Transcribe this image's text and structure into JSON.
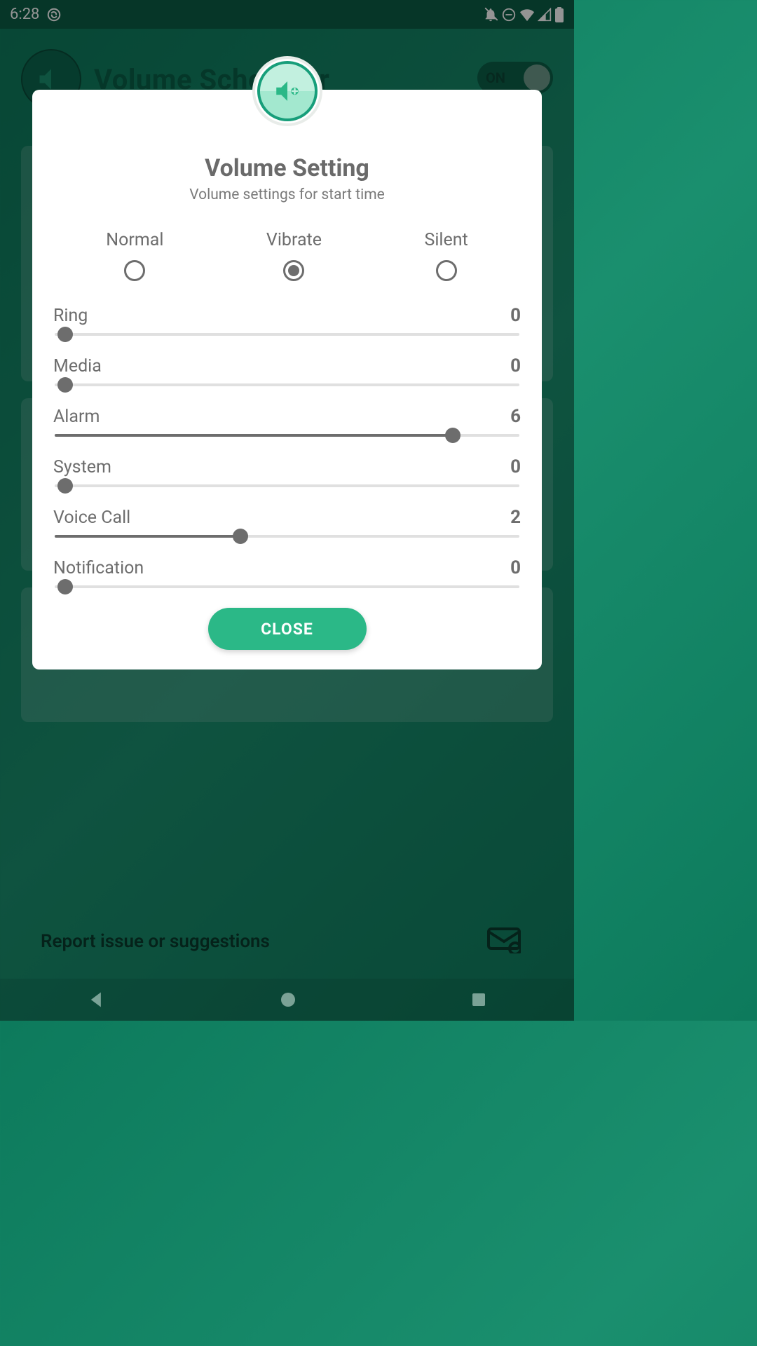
{
  "status": {
    "time": "6:28"
  },
  "background": {
    "title": "Volume Scheduler",
    "toggle_label": "ON",
    "report_label": "Report issue or suggestions"
  },
  "dialog": {
    "title": "Volume Setting",
    "subtitle": "Volume settings for start time",
    "modes": [
      {
        "label": "Normal",
        "selected": false
      },
      {
        "label": "Vibrate",
        "selected": true
      },
      {
        "label": "Silent",
        "selected": false
      }
    ],
    "sliders": [
      {
        "label": "Ring",
        "value": 0,
        "max": 7
      },
      {
        "label": "Media",
        "value": 0,
        "max": 7
      },
      {
        "label": "Alarm",
        "value": 6,
        "max": 7
      },
      {
        "label": "System",
        "value": 0,
        "max": 7
      },
      {
        "label": "Voice Call",
        "value": 2,
        "max": 5
      },
      {
        "label": "Notification",
        "value": 0,
        "max": 7
      }
    ],
    "close_label": "CLOSE"
  }
}
